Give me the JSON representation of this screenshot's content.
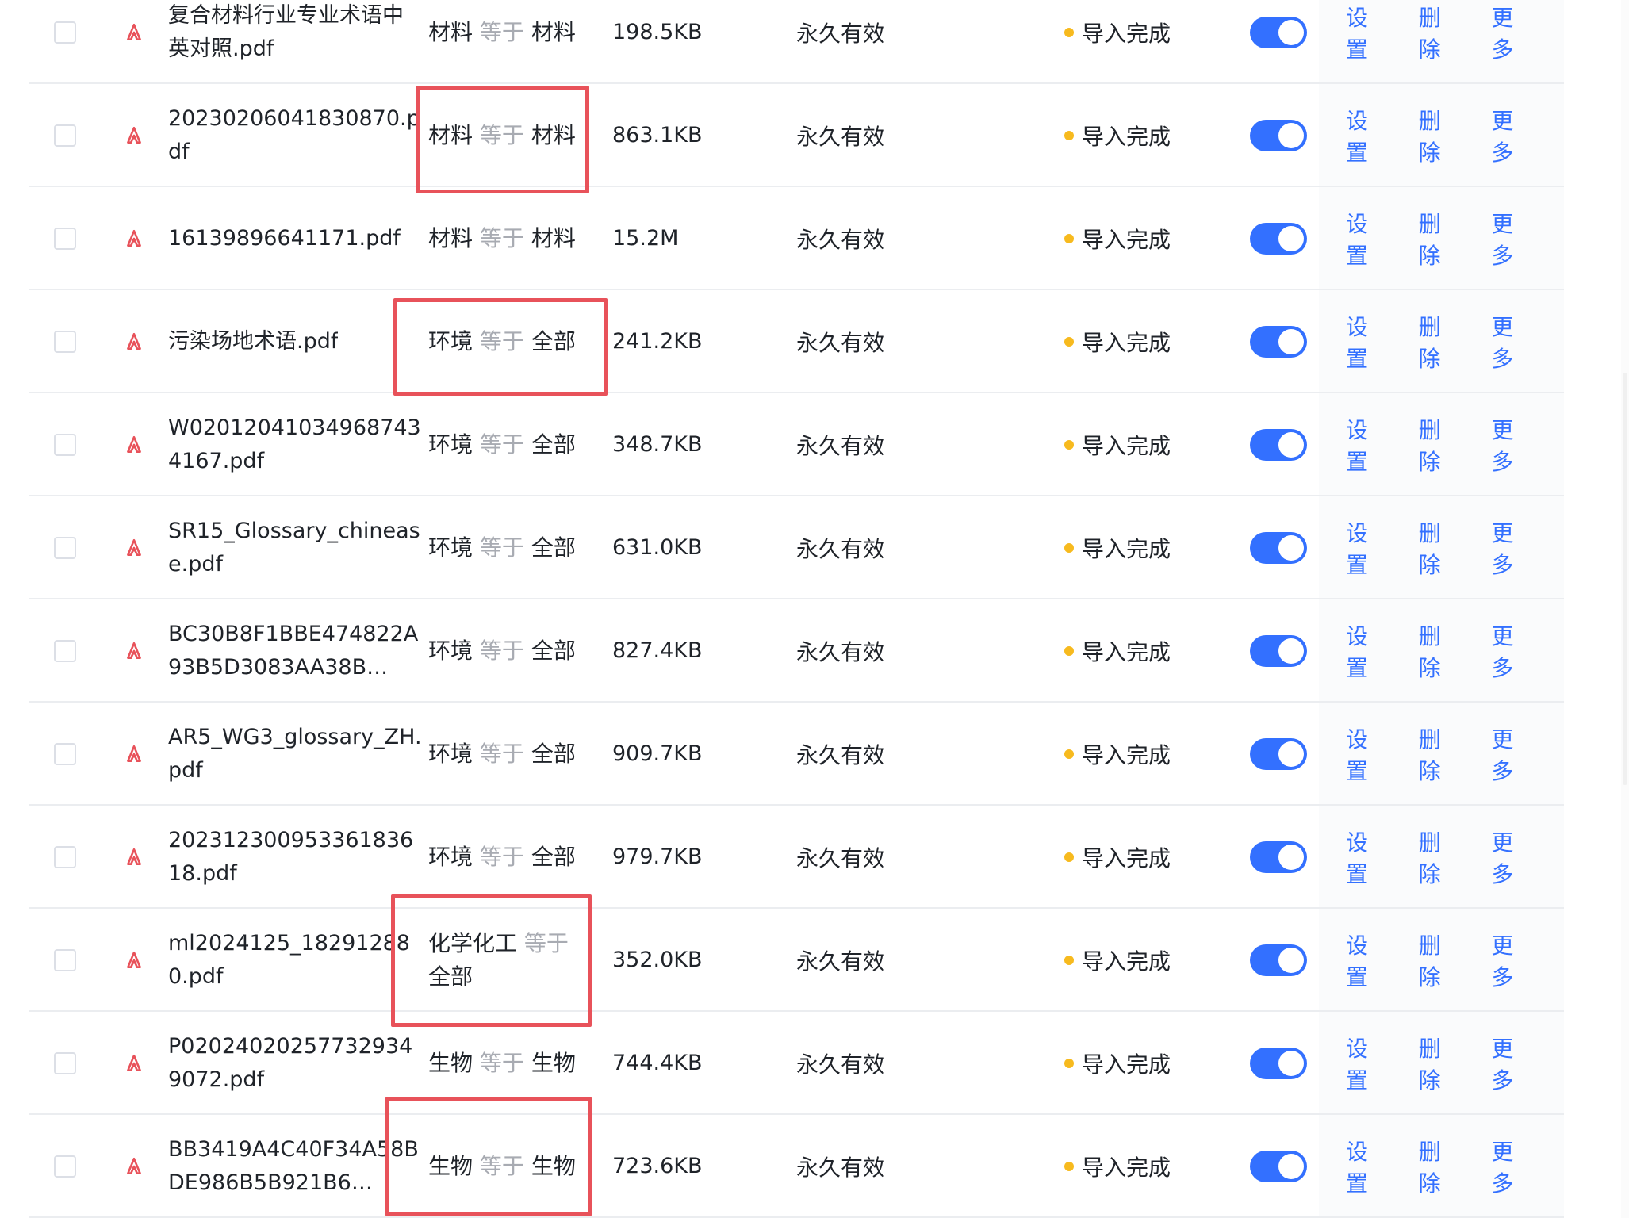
{
  "rows": [
    {
      "name": "复合材料行业专业术语中英对照.pdf",
      "field": "材料",
      "op": "等于",
      "scope": "材料",
      "size": "198.5KB",
      "validity": "永久有效",
      "status": "导入完成"
    },
    {
      "name": "20230206041830870.pdf",
      "field": "材料",
      "op": "等于",
      "scope": "材料",
      "size": "863.1KB",
      "validity": "永久有效",
      "status": "导入完成"
    },
    {
      "name": "16139896641171.pdf",
      "field": "材料",
      "op": "等于",
      "scope": "材料",
      "size": "15.2M",
      "validity": "永久有效",
      "status": "导入完成"
    },
    {
      "name": "污染场地术语.pdf",
      "field": "环境",
      "op": "等于",
      "scope": "全部",
      "size": "241.2KB",
      "validity": "永久有效",
      "status": "导入完成"
    },
    {
      "name": "W020120410349687434167.pdf",
      "field": "环境",
      "op": "等于",
      "scope": "全部",
      "size": "348.7KB",
      "validity": "永久有效",
      "status": "导入完成"
    },
    {
      "name": "SR15_Glossary_chinease.pdf",
      "field": "环境",
      "op": "等于",
      "scope": "全部",
      "size": "631.0KB",
      "validity": "永久有效",
      "status": "导入完成"
    },
    {
      "name": "BC30B8F1BBE474822A93B5D3083AA38B…",
      "field": "环境",
      "op": "等于",
      "scope": "全部",
      "size": "827.4KB",
      "validity": "永久有效",
      "status": "导入完成"
    },
    {
      "name": "AR5_WG3_glossary_ZH.pdf",
      "field": "环境",
      "op": "等于",
      "scope": "全部",
      "size": "909.7KB",
      "validity": "永久有效",
      "status": "导入完成"
    },
    {
      "name": "20231230095336183618.pdf",
      "field": "环境",
      "op": "等于",
      "scope": "全部",
      "size": "979.7KB",
      "validity": "永久有效",
      "status": "导入完成"
    },
    {
      "name": "ml2024125_182912880.pdf",
      "field": "化学化工",
      "op": "等于",
      "scope": "全部",
      "size": "352.0KB",
      "validity": "永久有效",
      "status": "导入完成"
    },
    {
      "name": "P020240202577329349072.pdf",
      "field": "生物",
      "op": "等于",
      "scope": "生物",
      "size": "744.4KB",
      "validity": "永久有效",
      "status": "导入完成"
    },
    {
      "name": "BB3419A4C40F34A58BDE986B5B921B6…",
      "field": "生物",
      "op": "等于",
      "scope": "生物",
      "size": "723.6KB",
      "validity": "永久有效",
      "status": "导入完成"
    }
  ],
  "actions": {
    "settings": "设置",
    "delete": "删除",
    "more": "更多"
  },
  "icons": {
    "file": "pdf-file-icon"
  },
  "colors": {
    "accent": "#3370ff",
    "status_dot": "#f7ba1e",
    "highlight": "#e8525a",
    "operator": "#a8abb2"
  }
}
